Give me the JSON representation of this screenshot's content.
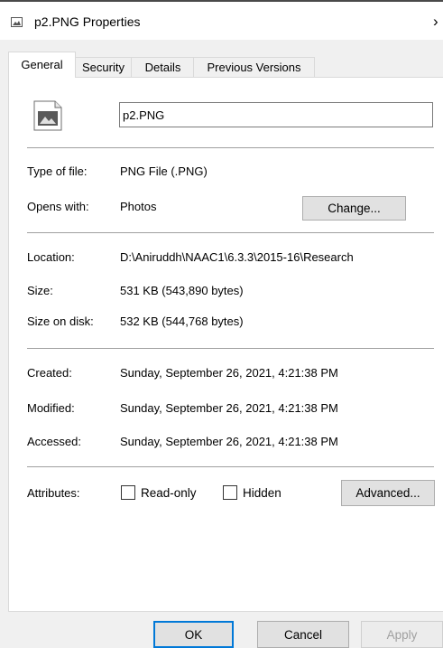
{
  "window": {
    "title": "p2.PNG Properties",
    "close_glyph": "›"
  },
  "tabs": [
    {
      "label": "General",
      "active": true
    },
    {
      "label": "Security",
      "active": false
    },
    {
      "label": "Details",
      "active": false
    },
    {
      "label": "Previous Versions",
      "active": false
    }
  ],
  "file": {
    "icon": "image-file-icon",
    "name": "p2.PNG"
  },
  "type": {
    "type_label": "Type of file:",
    "type_value": "PNG File (.PNG)",
    "opens_label": "Opens with:",
    "opens_value": "Photos",
    "change_label": "Change..."
  },
  "location": {
    "location_label": "Location:",
    "location_value": "D:\\Aniruddh\\NAAC1\\6.3.3\\2015-16\\Research",
    "size_label": "Size:",
    "size_value": "531 KB (543,890 bytes)",
    "disk_label": "Size on disk:",
    "disk_value": "532 KB (544,768 bytes)"
  },
  "dates": {
    "created_label": "Created:",
    "created_value": "Sunday, September 26, 2021, 4:21:38 PM",
    "modified_label": "Modified:",
    "modified_value": "Sunday, September 26, 2021, 4:21:38 PM",
    "accessed_label": "Accessed:",
    "accessed_value": "Sunday, September 26, 2021, 4:21:38 PM"
  },
  "attributes": {
    "label": "Attributes:",
    "readonly_label": "Read-only",
    "readonly_checked": false,
    "hidden_label": "Hidden",
    "hidden_checked": false,
    "advanced_label": "Advanced..."
  },
  "buttons": {
    "ok": "OK",
    "cancel": "Cancel",
    "apply": "Apply"
  },
  "colors": {
    "panel": "#ffffff",
    "window_bg": "#f0f0f0",
    "button": "#e1e1e1",
    "disabled_text": "#a0a0a0"
  }
}
